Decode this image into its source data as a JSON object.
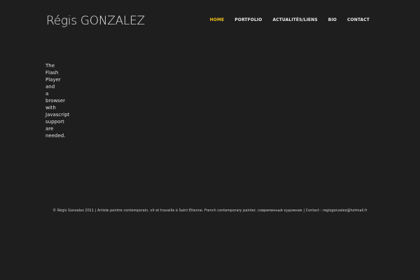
{
  "header": {
    "site_title": "Régis GONZALEZ"
  },
  "nav": {
    "items": [
      {
        "label": "HOME",
        "active": true
      },
      {
        "label": "PORTFOLIO",
        "active": false
      },
      {
        "label": "ACTUALITÉS/LIENS",
        "active": false
      },
      {
        "label": "BIO",
        "active": false
      },
      {
        "label": "CONTACT",
        "active": false
      }
    ]
  },
  "main": {
    "flash_notice": "The Flash Player and a browser with Javascript support are needed."
  },
  "footer": {
    "text": "© Régis Gonzalez 2011 | Artiste peintre contemporain, vit et travaille à Saint Etienne. French contemporary painter, современный художник | Contact : regisgonzalez@hotmail.fr"
  },
  "colors": {
    "background": "#1e1e1e",
    "text": "#e6e6e6",
    "accent": "#f2c21b"
  }
}
